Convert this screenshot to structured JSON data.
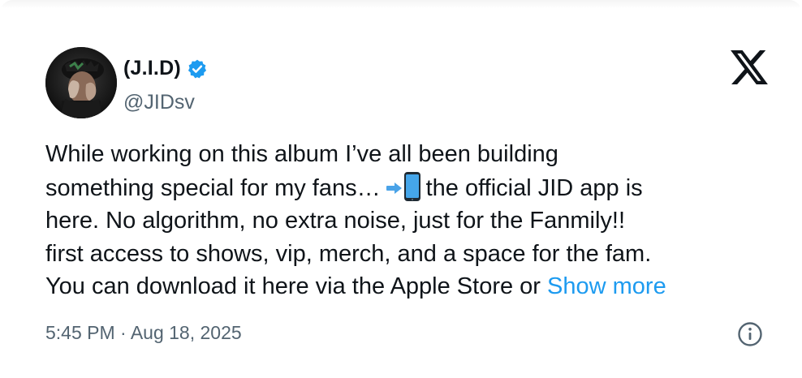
{
  "author": {
    "display_name": "(J.I.D)",
    "handle": "@JIDsv",
    "verified": true,
    "verified_color": "#1d9bf0"
  },
  "platform": {
    "logo_icon": "x-logo-icon"
  },
  "tweet": {
    "lines": [
      "While working on this album I’ve all been building",
      "something special for my fans…",
      "the official JID app is",
      "here. No algorithm, no extra noise, just for the Fanmily!!",
      "first access to shows, vip, merch, and a space for the fam.",
      "You can download it here via the Apple Store or"
    ],
    "emojis": [
      "right-arrow-emoji",
      "mobile-phone-emoji"
    ],
    "show_more_label": "Show more",
    "show_more_color": "#1d9bf0"
  },
  "meta": {
    "timestamp": "5:45 PM · Aug 18, 2025",
    "info_icon": "info-icon"
  },
  "colors": {
    "text_primary": "#0f1419",
    "text_secondary": "#536471",
    "link": "#1d9bf0",
    "background": "#ffffff"
  }
}
